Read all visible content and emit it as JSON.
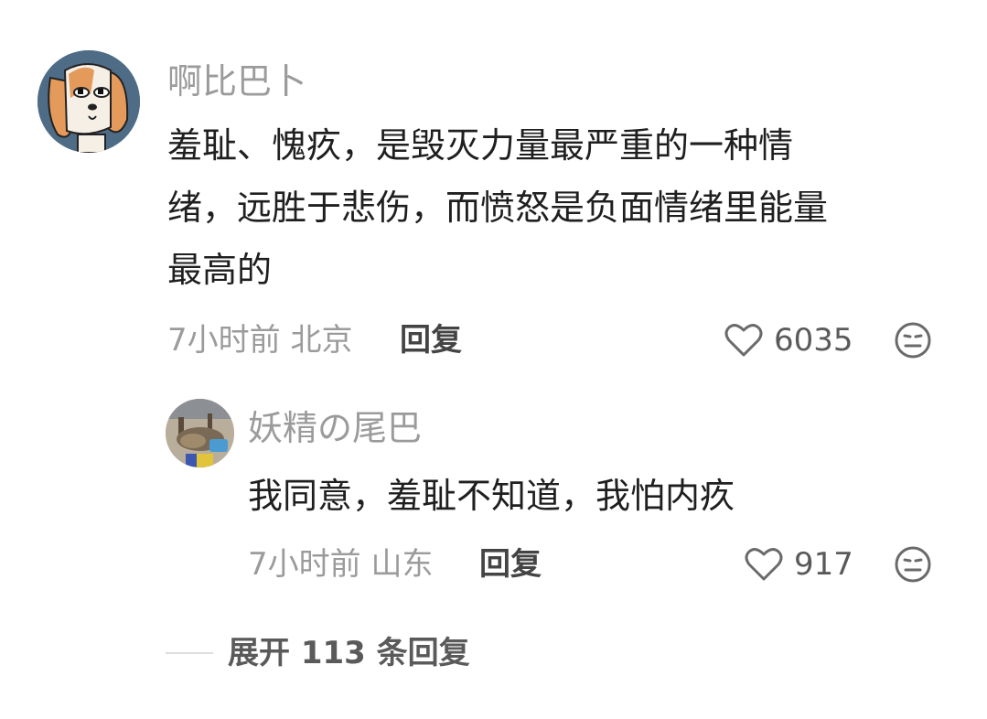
{
  "comment": {
    "username": "啊比巴卜",
    "text": "羞耻、愧疚，是毁灭力量最严重的一种情绪，远胜于悲伤，而愤怒是负面情绪里能量最高的",
    "lines": [
      "羞耻、愧疚，是毁灭力量最严重的一种情",
      "绪，远胜于悲伤，而愤怒是负面情绪里能量",
      "最高的"
    ],
    "time": "7小时前",
    "location": "北京",
    "reply_label": "回复",
    "likes": "6035",
    "avatar_icon": "cartoon-dog-avatar",
    "like_icon": "heart-outline-icon",
    "dislike_icon": "meh-face-icon"
  },
  "reply": {
    "username": "妖精の尾巴",
    "text": "我同意，羞耻不知道，我怕内疚",
    "time": "7小时前",
    "location": "山东",
    "reply_label": "回复",
    "likes": "917",
    "avatar_icon": "photo-avatar",
    "like_icon": "heart-outline-icon",
    "dislike_icon": "meh-face-icon"
  },
  "expand": {
    "label": "展开 113 条回复"
  },
  "colors": {
    "meta_gray": "#9b9b9b",
    "text_dark": "#1f1f1f",
    "avatar_bg": "#4f6c86"
  }
}
